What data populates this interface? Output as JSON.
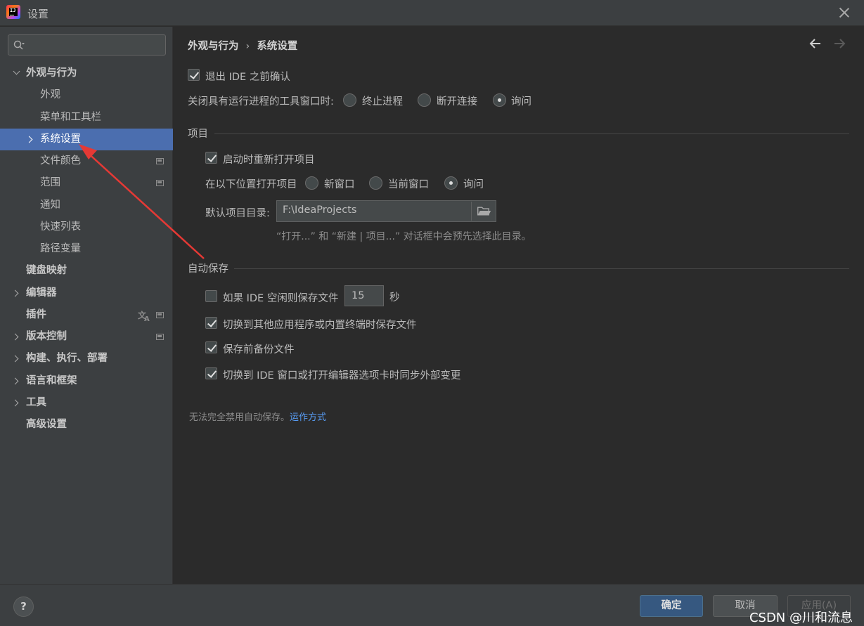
{
  "window": {
    "title": "设置"
  },
  "sidebar": {
    "search": {
      "placeholder": ""
    },
    "items": [
      {
        "label": "外观与行为"
      },
      {
        "label": "外观"
      },
      {
        "label": "菜单和工具栏"
      },
      {
        "label": "系统设置"
      },
      {
        "label": "文件颜色"
      },
      {
        "label": "范围"
      },
      {
        "label": "通知"
      },
      {
        "label": "快速列表"
      },
      {
        "label": "路径变量"
      },
      {
        "label": "键盘映射"
      },
      {
        "label": "编辑器"
      },
      {
        "label": "插件"
      },
      {
        "label": "版本控制"
      },
      {
        "label": "构建、执行、部署"
      },
      {
        "label": "语言和框架"
      },
      {
        "label": "工具"
      },
      {
        "label": "高级设置"
      }
    ]
  },
  "main": {
    "breadcrumb": {
      "parent": "外观与行为",
      "separator": "›",
      "current": "系统设置"
    },
    "confirm_exit": {
      "label": "退出 IDE 之前确认",
      "checked": true
    },
    "close_tool_window": {
      "label": "关闭具有运行进程的工具窗口时:",
      "options": [
        "终止进程",
        "断开连接",
        "询问"
      ],
      "selected": "询问"
    },
    "project_section": {
      "title": "项目",
      "reopen": {
        "label": "启动时重新打开项目",
        "checked": true
      },
      "open_location": {
        "label": "在以下位置打开项目",
        "options": [
          "新窗口",
          "当前窗口",
          "询问"
        ],
        "selected": "询问"
      },
      "default_dir": {
        "label": "默认项目目录:",
        "value": "F:\\IdeaProjects"
      },
      "hint": "“打开...” 和 “新建 | 项目...” 对话框中会预先选择此目录。"
    },
    "autosave_section": {
      "title": "自动保存",
      "idle": {
        "label": "如果 IDE 空闲则保存文件",
        "value": "15",
        "unit": "秒",
        "checked": false
      },
      "switch_app": {
        "label": "切换到其他应用程序或内置终端时保存文件",
        "checked": true
      },
      "backup": {
        "label": "保存前备份文件",
        "checked": true
      },
      "sync": {
        "label": "切换到 IDE 窗口或打开编辑器选项卡时同步外部变更",
        "checked": true
      }
    },
    "bottom_note": {
      "text": "无法完全禁用自动保存。",
      "link": "运作方式"
    }
  },
  "footer": {
    "help": "?",
    "ok": "确定",
    "cancel": "取消",
    "apply": "应用(A)"
  },
  "watermark": "CSDN @川和流息",
  "colors": {
    "selection": "#4b6eaf",
    "ok_button": "#365880",
    "link": "#589df6",
    "annotation_arrow": "#e53935"
  }
}
